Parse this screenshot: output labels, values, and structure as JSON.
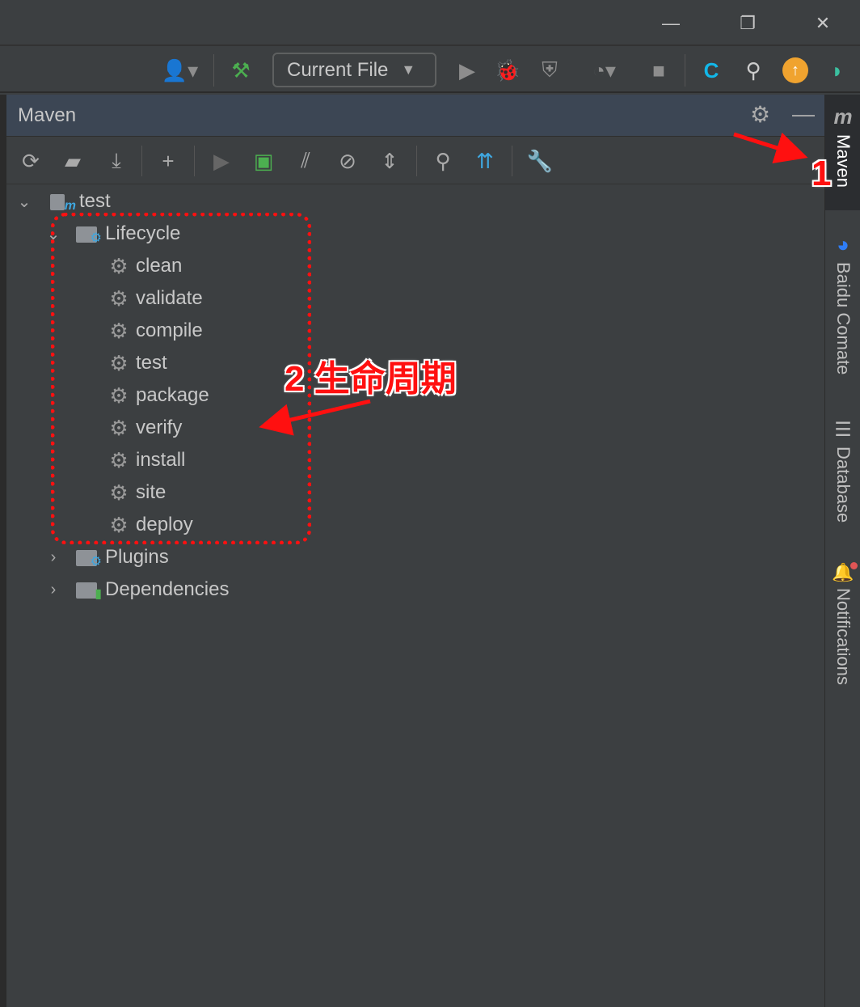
{
  "window": {
    "minimize_icon": "minimize-icon",
    "restore_icon": "restore-icon",
    "close_icon": "close-icon"
  },
  "toolbar": {
    "run_config": "Current File"
  },
  "panel": {
    "title": "Maven"
  },
  "tree": {
    "root": "test",
    "lifecycle": "Lifecycle",
    "phases": [
      "clean",
      "validate",
      "compile",
      "test",
      "package",
      "verify",
      "install",
      "site",
      "deploy"
    ],
    "plugins": "Plugins",
    "dependencies": "Dependencies"
  },
  "side_tabs": [
    "Maven",
    "Baidu Comate",
    "Database",
    "Notifications"
  ],
  "annotations": {
    "label1": "1",
    "label2": "2 生命周期"
  },
  "colors": {
    "annotation": "#ff1010",
    "accent_blue": "#3fa7e0",
    "panel_header": "#3c4654"
  }
}
